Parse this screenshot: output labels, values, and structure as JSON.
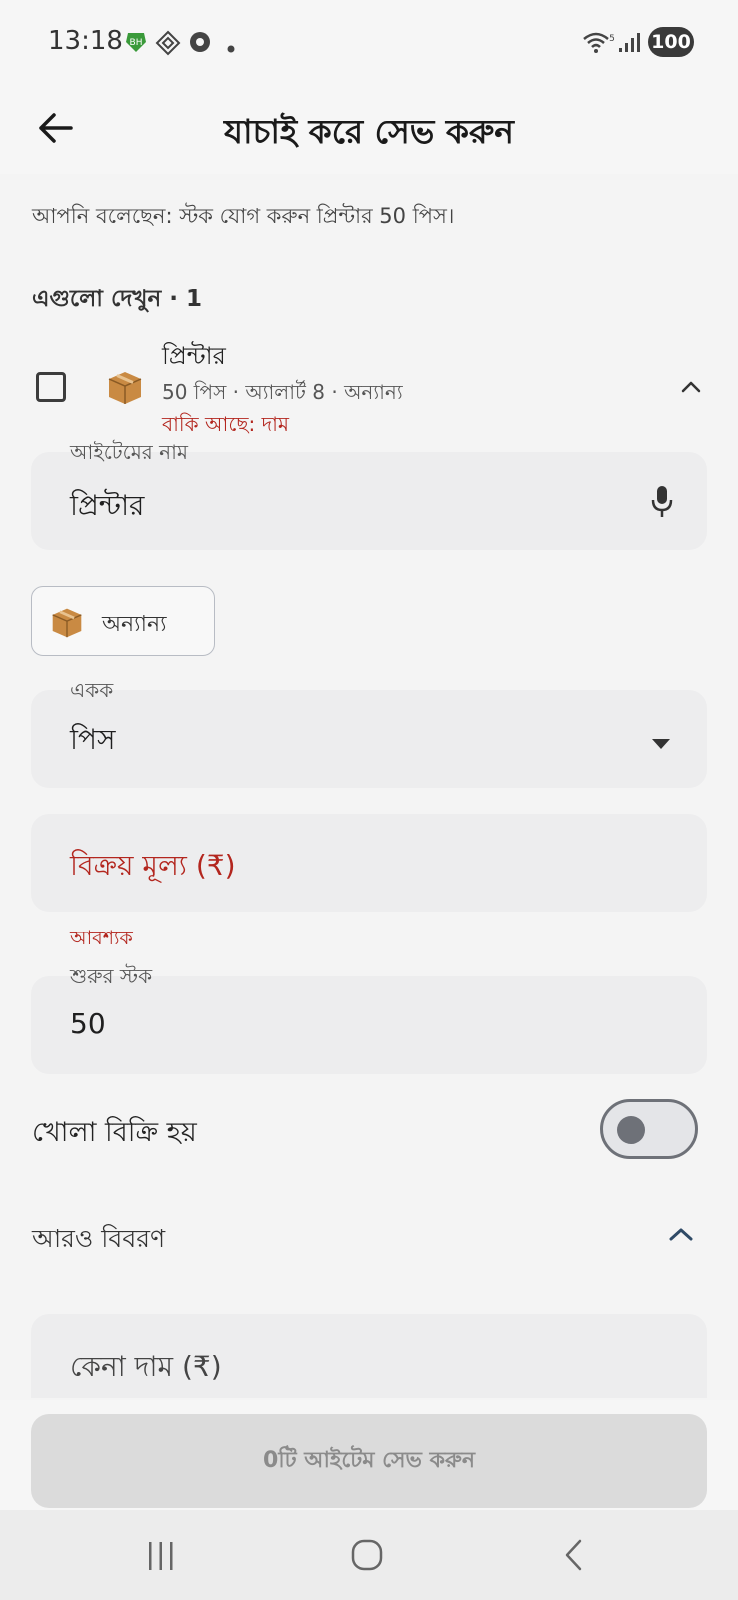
{
  "status_bar": {
    "time": "13:18",
    "app_badge": "BH",
    "battery": "100",
    "network": "5"
  },
  "header": {
    "title": "যাচাই করে সেভ করুন"
  },
  "summary": {
    "said_text": "আপনি বলেছেন: স্টক যোগ করুন প্রিন্টার 50 পিস।"
  },
  "review": {
    "section_title": "এগুলো দেখুন · 1",
    "item": {
      "name": "প্রিন্টার",
      "meta": "50 পিস · অ্যালার্ট 8 · অন্যান্য",
      "missing": "বাকি আছে: দাম",
      "checked": false
    }
  },
  "form": {
    "name_field": {
      "label": "আইটেমের নাম",
      "value": "প্রিন্টার"
    },
    "category_chip": {
      "label": "অন্যান্য"
    },
    "unit_field": {
      "label": "একক",
      "value": "পিস"
    },
    "price_field": {
      "placeholder": "বিক্রয় মূল্য (₹)",
      "helper": "আবশ্যক"
    },
    "stock_field": {
      "label": "শুরুর স্টক",
      "value": "50"
    },
    "loose_sale": {
      "label": "খোলা বিক্রি হয়",
      "enabled": false
    },
    "more_details": {
      "label": "আরও বিবরণ"
    },
    "cost_field": {
      "placeholder": "কেনা দাম (₹)"
    }
  },
  "footer": {
    "save_label": "0টি আইটেম সেভ করুন"
  },
  "colors": {
    "error": "#b3261e",
    "field_bg": "#ededee",
    "accent": "#2f4a66"
  },
  "icons": [
    "back-arrow-icon",
    "mic-icon",
    "box-icon",
    "chevron-up-icon",
    "dropdown-arrow-icon",
    "recents-icon",
    "home-icon",
    "back-nav-icon"
  ]
}
